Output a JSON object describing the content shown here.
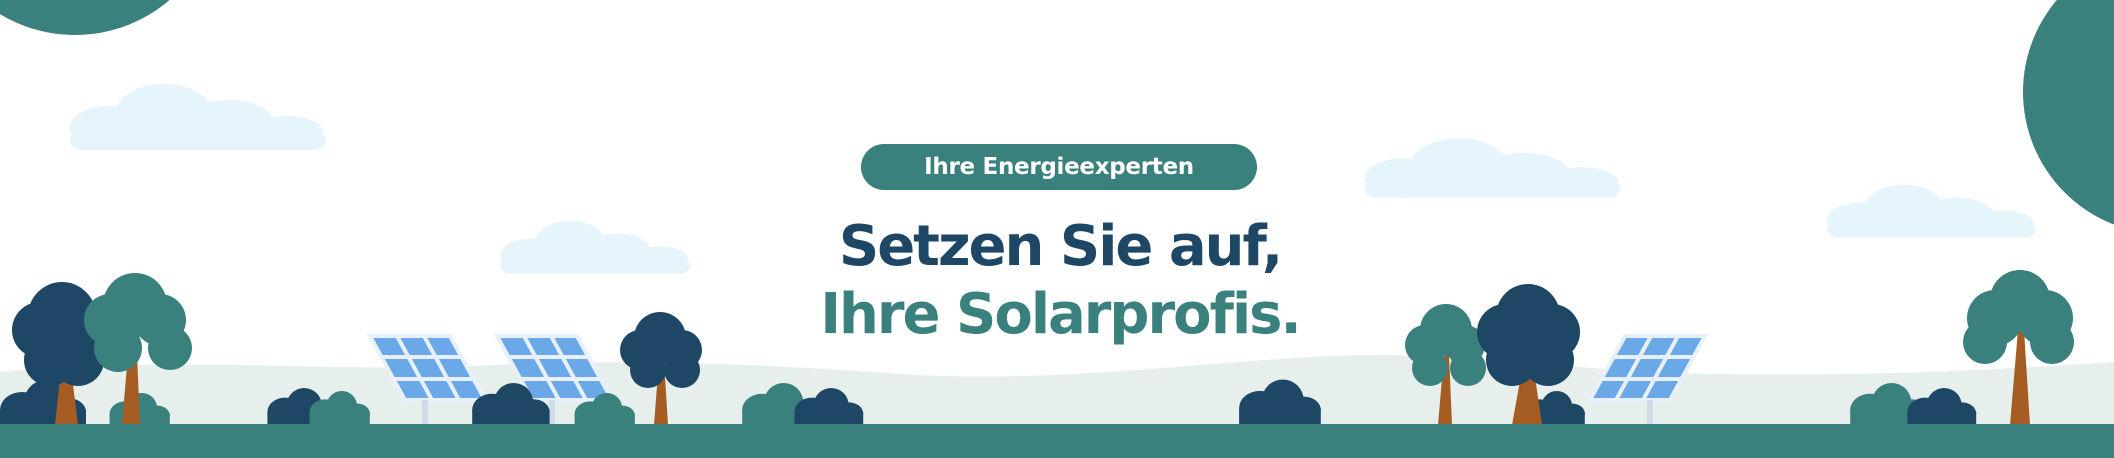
{
  "banner": {
    "eyebrow": "Ihre Energieexperten",
    "headline_line1": "Setzen Sie auf,",
    "headline_line2": "Ihre Solarprofis."
  },
  "colors": {
    "teal": "#3a807d",
    "navy": "#1e4766",
    "cloud": "#e6f4fb",
    "hill": "#e6efeb",
    "panel": "#6aa8e8",
    "trunk": "#a55c22",
    "background": "#ffffff"
  },
  "icons": [
    "tree-icon",
    "bush-icon",
    "solar-panel-icon",
    "cloud-icon"
  ]
}
